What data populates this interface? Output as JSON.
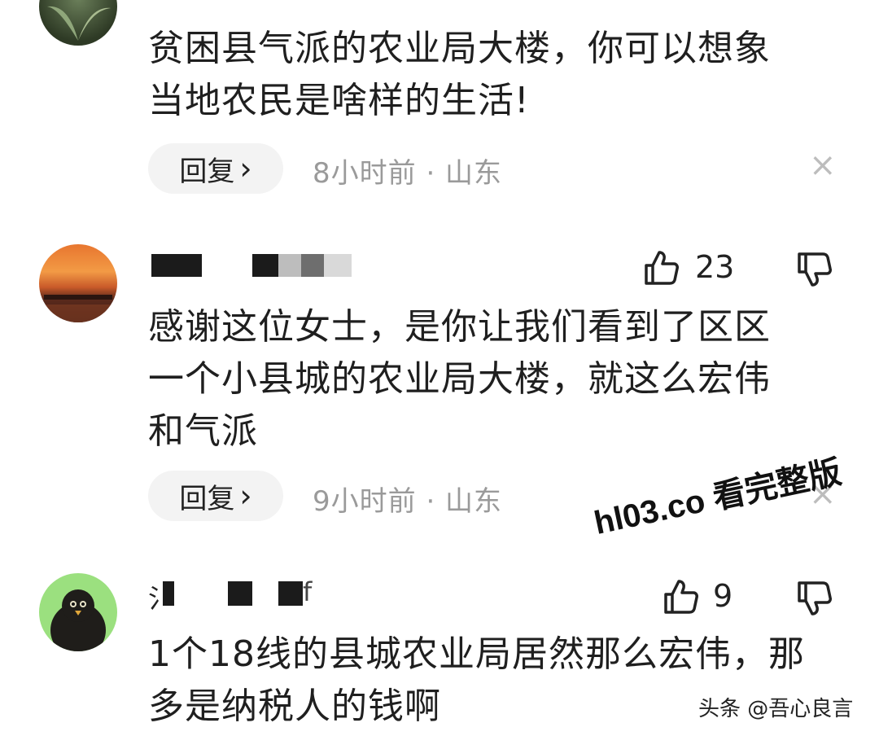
{
  "comments": [
    {
      "text_lines": [
        "贫困县气派的农业局大楼，你可以想象",
        "当地农民是啥样的生活!"
      ],
      "reply_label": "回复",
      "reply_chevron": "›",
      "meta": "8小时前 · 山东",
      "close_icon": "×"
    },
    {
      "like_count": "23",
      "text_lines": [
        "感谢这位女士，是你让我们看到了区区",
        "一个小县城的农业局大楼，就这么宏伟",
        "和气派"
      ],
      "reply_label": "回复",
      "reply_chevron": "›",
      "meta": "9小时前 · 山东",
      "close_icon": "×"
    },
    {
      "username_fragment_start": "氵",
      "username_fragment_end": "f",
      "like_count": "9",
      "text_lines": [
        "1个18线的县城农业局居然那么宏伟，那",
        "多是纳税人的钱啊"
      ]
    }
  ],
  "watermark": "hl03.co 看完整版",
  "source_credit": "头条 @吾心良言",
  "icons": {
    "like": "thumbs-up-icon",
    "dislike": "thumbs-down-icon",
    "close": "close-icon"
  }
}
